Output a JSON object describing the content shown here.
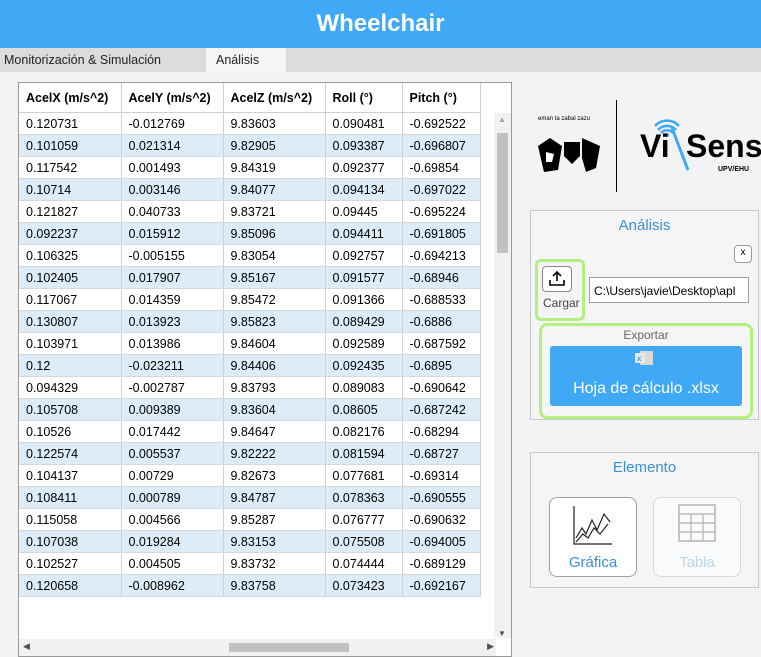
{
  "app": {
    "title": "Wheelchair"
  },
  "tabs": [
    {
      "label": "Monitorización & Simulación"
    },
    {
      "label": "Análisis"
    }
  ],
  "table": {
    "columns": [
      "AcelX (m/s^2)",
      "AcelY (m/s^2)",
      "AcelZ (m/s^2)",
      "Roll (°)",
      "Pitch (°)"
    ],
    "rows": [
      [
        "0.120731",
        "-0.012769",
        "9.83603",
        "0.090481",
        "-0.692522"
      ],
      [
        "0.101059",
        "0.021314",
        "9.82905",
        "0.093387",
        "-0.696807"
      ],
      [
        "0.117542",
        "0.001493",
        "9.84319",
        "0.092377",
        "-0.69854"
      ],
      [
        "0.10714",
        "0.003146",
        "9.84077",
        "0.094134",
        "-0.697022"
      ],
      [
        "0.121827",
        "0.040733",
        "9.83721",
        "0.09445",
        "-0.695224"
      ],
      [
        "0.092237",
        "0.015912",
        "9.85096",
        "0.094411",
        "-0.691805"
      ],
      [
        "0.106325",
        "-0.005155",
        "9.83054",
        "0.092757",
        "-0.694213"
      ],
      [
        "0.102405",
        "0.017907",
        "9.85167",
        "0.091577",
        "-0.68946"
      ],
      [
        "0.117067",
        "0.014359",
        "9.85472",
        "0.091366",
        "-0.688533"
      ],
      [
        "0.130807",
        "0.013923",
        "9.85823",
        "0.089429",
        "-0.6886"
      ],
      [
        "0.103971",
        "0.013986",
        "9.84604",
        "0.092589",
        "-0.687592"
      ],
      [
        "0.12",
        "-0.023211",
        "9.84406",
        "0.092435",
        "-0.6895"
      ],
      [
        "0.094329",
        "-0.002787",
        "9.83793",
        "0.089083",
        "-0.690642"
      ],
      [
        "0.105708",
        "0.009389",
        "9.83604",
        "0.08605",
        "-0.687242"
      ],
      [
        "0.10526",
        "0.017442",
        "9.84647",
        "0.082176",
        "-0.68294"
      ],
      [
        "0.122574",
        "0.005537",
        "9.82222",
        "0.081594",
        "-0.68727"
      ],
      [
        "0.104137",
        "0.00729",
        "9.82673",
        "0.077681",
        "-0.69314"
      ],
      [
        "0.108411",
        "0.000789",
        "9.84787",
        "0.078363",
        "-0.690555"
      ],
      [
        "0.115058",
        "0.004566",
        "9.85287",
        "0.076777",
        "-0.690632"
      ],
      [
        "0.107038",
        "0.019284",
        "9.83153",
        "0.075508",
        "-0.694005"
      ],
      [
        "0.102527",
        "0.004505",
        "9.83732",
        "0.074444",
        "-0.689129"
      ],
      [
        "0.120658",
        "-0.008962",
        "9.83758",
        "0.073423",
        "-0.692167"
      ]
    ]
  },
  "logos": {
    "left_text": "eman ta zabal zazu",
    "brand_vi": "Vi",
    "brand_sens": "Sens",
    "brand_sub": "UPV/EHU"
  },
  "analisis": {
    "title": "Análisis",
    "close_label": "x",
    "cargar_label": "Cargar",
    "path_value": "C:\\Users\\javie\\Desktop\\apl",
    "exportar_label": "Exportar",
    "export_button_label": "Hoja de cálculo .xlsx"
  },
  "elemento": {
    "title": "Elemento",
    "grafica_label": "Gráfica",
    "tabla_label": "Tabla"
  },
  "colors": {
    "accent": "#3fa9f5",
    "highlight": "#b4ef82",
    "row_alt": "#dcecf8"
  }
}
